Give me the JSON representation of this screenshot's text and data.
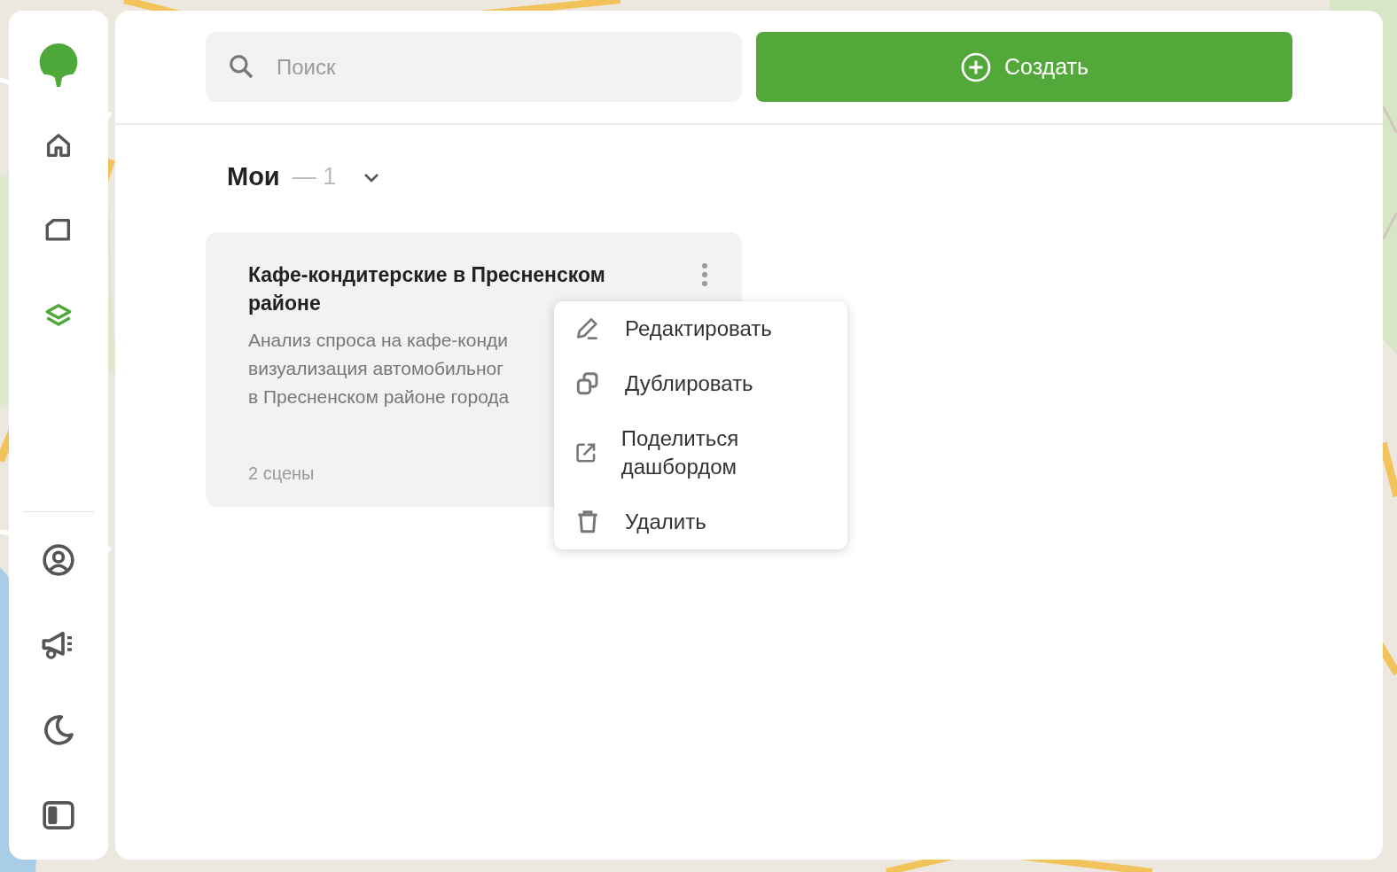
{
  "sidebar": {
    "nav": [
      {
        "kind": "home",
        "selected": false
      },
      {
        "kind": "folder",
        "selected": false
      },
      {
        "kind": "layers",
        "selected": true
      }
    ],
    "bottom": [
      {
        "kind": "profile"
      },
      {
        "kind": "megaphone"
      },
      {
        "kind": "moon"
      },
      {
        "kind": "panel"
      }
    ]
  },
  "search": {
    "placeholder": "Поиск"
  },
  "create_button": {
    "label": "Создать"
  },
  "section": {
    "title": "Мои",
    "count": "— 1",
    "expanded": true
  },
  "cards": [
    {
      "title": "Кафе-кондитерские в Пресненском районе",
      "description_lines": [
        "Анализ спроса на кафе-конди",
        "визуализация автомобильног",
        "в Пресненском районе города"
      ],
      "meta": "2 сцены"
    }
  ],
  "context_menu": {
    "items": [
      {
        "kind": "edit",
        "label": "Редактировать"
      },
      {
        "kind": "duplicate",
        "label": "Дублировать"
      },
      {
        "kind": "share",
        "label": "Поделиться дашбордом"
      },
      {
        "kind": "delete",
        "label": "Удалить"
      }
    ]
  }
}
